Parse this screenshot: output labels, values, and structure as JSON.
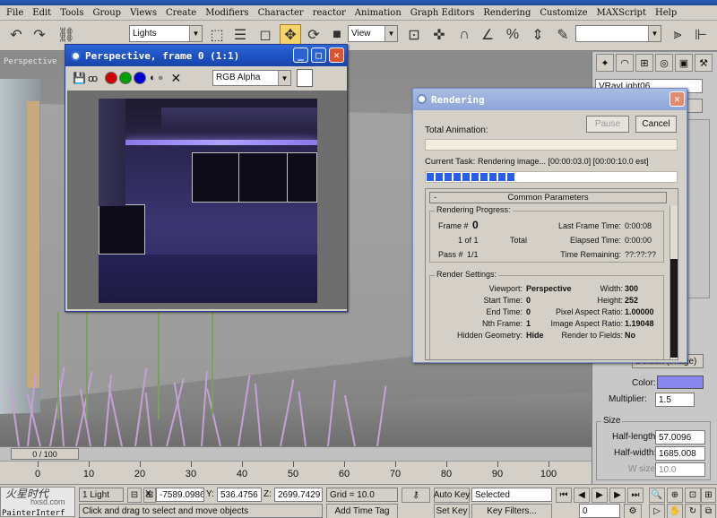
{
  "menubar": {
    "items": [
      "File",
      "Edit",
      "Tools",
      "Group",
      "Views",
      "Create",
      "Modifiers",
      "Character",
      "reactor",
      "Animation",
      "Graph Editors",
      "Rendering",
      "Customize",
      "MAXScript",
      "Help"
    ]
  },
  "toolbar": {
    "selection_filter": "Lights",
    "reference_coord": "View"
  },
  "viewport": {
    "label": "Perspective"
  },
  "vfb": {
    "title": "Perspective, frame 0 (1:1)",
    "channel": "RGB Alpha",
    "swatches": {
      "red": "#d00000",
      "green": "#00a000",
      "blue": "#0000d0"
    }
  },
  "render_dialog": {
    "title": "Rendering",
    "total_animation_label": "Total Animation:",
    "pause_label": "Pause",
    "cancel_label": "Cancel",
    "current_task_label": "Current Task:",
    "current_task": "Rendering image... [00:00:03.0] [00:00:10.0 est]",
    "task_progress": 0.35,
    "panel_title": "Common Parameters",
    "progress_group": "Rendering Progress:",
    "frame_label": "Frame #",
    "frame_value": "0",
    "frame_count": "1 of 1",
    "total_label": "Total",
    "pass_label": "Pass #",
    "pass_value": "1/1",
    "last_frame_time_label": "Last Frame Time:",
    "last_frame_time": "0:00:08",
    "elapsed_time_label": "Elapsed Time:",
    "elapsed_time": "0:00:00",
    "time_remaining_label": "Time Remaining:",
    "time_remaining": "??:??:??",
    "settings_group": "Render Settings:",
    "viewport_label": "Viewport:",
    "viewport_value": "Perspective",
    "start_time_label": "Start Time:",
    "start_time": "0",
    "end_time_label": "End Time:",
    "end_time": "0",
    "nth_frame_label": "Nth Frame:",
    "nth_frame": "1",
    "hidden_geom_label": "Hidden Geometry:",
    "hidden_geom": "Hide",
    "width_label": "Width:",
    "width": "300",
    "height_label": "Height:",
    "height": "252",
    "pixel_aspect_label": "Pixel Aspect Ratio:",
    "pixel_aspect": "1.00000",
    "image_aspect_label": "Image Aspect Ratio:",
    "image_aspect": "1.19048",
    "render_fields_label": "Render to Fields:",
    "render_fields": "No"
  },
  "command_panel": {
    "object_name": "VRayLight06",
    "color_label": "Color:",
    "color_swatch": "#8a86f0",
    "multiplier_label": "Multiplier:",
    "multiplier": "1.5",
    "size_group": "Size",
    "half_length_label": "Half-length:",
    "half_length": "57.0096",
    "half_width_label": "Half-width:",
    "half_width": "1685.008",
    "w_size_label": "W size",
    "w_size": "10.0",
    "units_dropdown": "Default (image)"
  },
  "timeline": {
    "slider_label": "0 / 100",
    "ticks": [
      "0",
      "10",
      "20",
      "30",
      "40",
      "50",
      "60",
      "70",
      "80",
      "90",
      "100"
    ]
  },
  "statusbar": {
    "selection": "1 Light",
    "x_label": "X:",
    "x_value": "-7589.0986",
    "y_label": "Y:",
    "y_value": "536.4756",
    "z_label": "Z:",
    "z_value": "2699.7429",
    "grid": "Grid = 10.0",
    "auto_key": "Auto Key",
    "set_key": "Set Key",
    "key_mode": "Selected",
    "key_filters": "Key Filters...",
    "frame": "0",
    "prompt": "Click and drag to select and move objects",
    "add_time_tag": "Add Time Tag",
    "maxscript_label": "PainterInterf",
    "watermark": "火星时代",
    "watermark_sub": "hxsd.com"
  }
}
